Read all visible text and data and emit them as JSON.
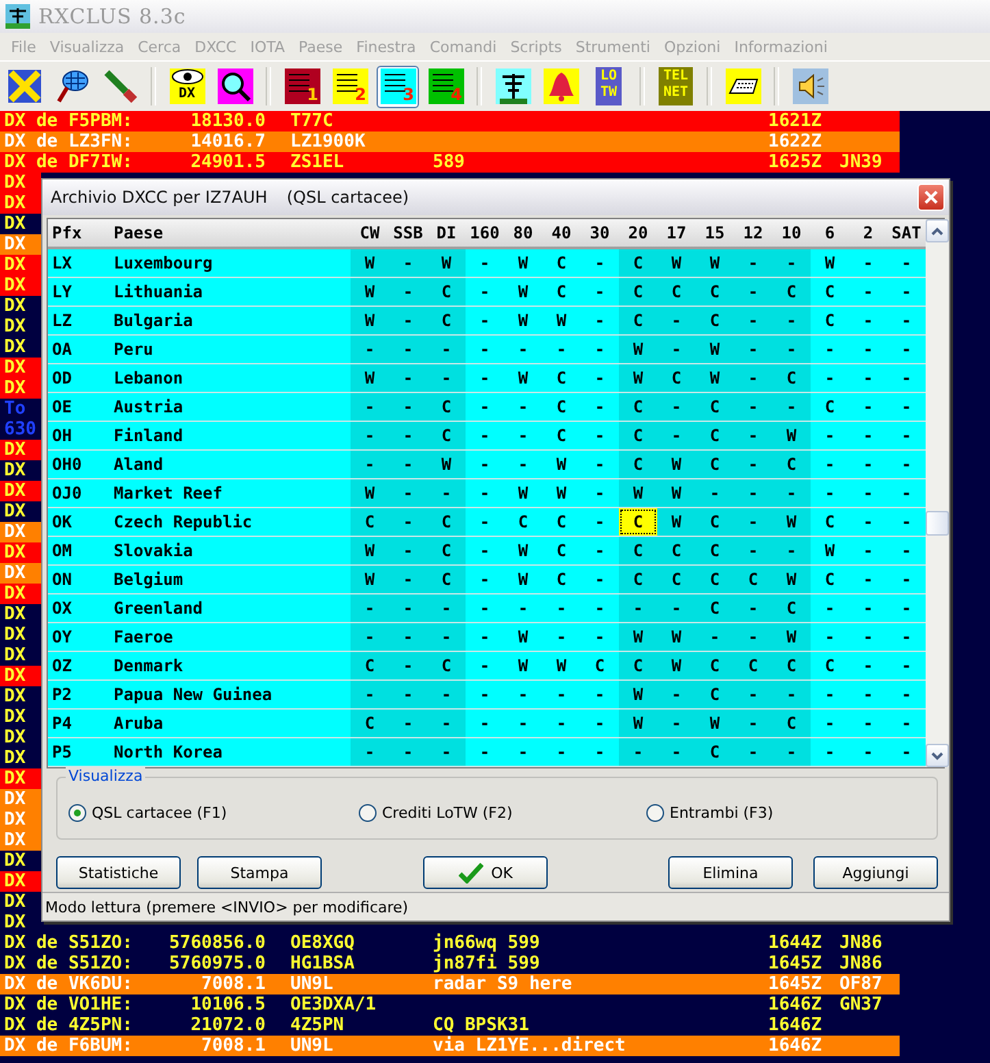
{
  "window": {
    "title": "RXCLUS 8.3c"
  },
  "menu": [
    "File",
    "Visualizza",
    "Cerca",
    "DXCC",
    "IOTA",
    "Paese",
    "Finestra",
    "Comandi",
    "Scripts",
    "Strumenti",
    "Opzioni",
    "Informazioni"
  ],
  "toolbar": [
    {
      "kind": "pencil",
      "selected": false
    },
    {
      "kind": "net",
      "selected": false
    },
    {
      "kind": "brush",
      "selected": false
    },
    {
      "kind": "separator"
    },
    {
      "kind": "eye",
      "label": "DX",
      "selected": false
    },
    {
      "kind": "magnifier",
      "selected": false
    },
    {
      "kind": "separator"
    },
    {
      "kind": "list",
      "label": "1",
      "color": "#b00020",
      "selected": false
    },
    {
      "kind": "list",
      "label": "2",
      "color": "#ffff00",
      "selected": false
    },
    {
      "kind": "list",
      "label": "3",
      "color": "#00ffff",
      "selected": true
    },
    {
      "kind": "list",
      "label": "4",
      "color": "#00c000",
      "selected": false
    },
    {
      "kind": "separator"
    },
    {
      "kind": "antenna",
      "selected": false
    },
    {
      "kind": "bell",
      "selected": false
    },
    {
      "kind": "letters",
      "label": "LOTW",
      "color": "#5a5ac8",
      "selected": false
    },
    {
      "kind": "separator"
    },
    {
      "kind": "letters",
      "label": "TELNET",
      "color": "#808000",
      "selected": false
    },
    {
      "kind": "separator"
    },
    {
      "kind": "keyboard",
      "selected": false
    },
    {
      "kind": "separator"
    },
    {
      "kind": "speaker",
      "selected": false
    }
  ],
  "spots": [
    {
      "kind": "spot",
      "color": "#ff0000",
      "de": "DX de F5PBM:",
      "freq": "18130.0",
      "dx": "T77C",
      "time": "1621Z"
    },
    {
      "kind": "spot",
      "color": "#ff8000",
      "de": "DX de LZ3FN:",
      "freq": "14016.7",
      "dx": "LZ1900K",
      "time": "1622Z"
    },
    {
      "kind": "spot",
      "color": "#ff0000",
      "de": "DX de DF7IW:",
      "freq": "24901.5",
      "dx": "ZS1EL",
      "comment": "589",
      "time": "1625Z",
      "locator": "JN39"
    },
    {
      "kind": "covered",
      "color": "#ff0000",
      "de": "DX"
    },
    {
      "kind": "covered",
      "color": "#ff0000",
      "de": "DX"
    },
    {
      "kind": "covered",
      "color": "#000040",
      "de": "DX"
    },
    {
      "kind": "covered",
      "color": "#ff8000",
      "de": "DX"
    },
    {
      "kind": "covered",
      "color": "#ff0000",
      "de": "DX"
    },
    {
      "kind": "covered",
      "color": "#ff0000",
      "de": "DX"
    },
    {
      "kind": "covered",
      "color": "#000040",
      "de": "DX"
    },
    {
      "kind": "covered",
      "color": "#000040",
      "de": "DX"
    },
    {
      "kind": "covered",
      "color": "#000040",
      "de": "DX"
    },
    {
      "kind": "covered",
      "color": "#ff0000",
      "de": "DX"
    },
    {
      "kind": "covered",
      "color": "#ff0000",
      "de": "DX"
    },
    {
      "kind": "message",
      "color": "#000040",
      "de": "To"
    },
    {
      "kind": "message",
      "color": "#000040",
      "de": "630"
    },
    {
      "kind": "covered",
      "color": "#ff0000",
      "de": "DX"
    },
    {
      "kind": "covered",
      "color": "#000040",
      "de": "DX"
    },
    {
      "kind": "covered",
      "color": "#ff0000",
      "de": "DX"
    },
    {
      "kind": "covered",
      "color": "#000040",
      "de": "DX"
    },
    {
      "kind": "covered",
      "color": "#ff8000",
      "de": "DX"
    },
    {
      "kind": "covered",
      "color": "#ff0000",
      "de": "DX"
    },
    {
      "kind": "covered",
      "color": "#ff8000",
      "de": "DX"
    },
    {
      "kind": "covered",
      "color": "#ff0000",
      "de": "DX"
    },
    {
      "kind": "covered",
      "color": "#000040",
      "de": "DX"
    },
    {
      "kind": "covered",
      "color": "#000040",
      "de": "DX"
    },
    {
      "kind": "covered",
      "color": "#000040",
      "de": "DX"
    },
    {
      "kind": "covered",
      "color": "#ff0000",
      "de": "DX"
    },
    {
      "kind": "covered",
      "color": "#000040",
      "de": "DX"
    },
    {
      "kind": "covered",
      "color": "#000040",
      "de": "DX"
    },
    {
      "kind": "covered",
      "color": "#000040",
      "de": "DX"
    },
    {
      "kind": "covered",
      "color": "#000040",
      "de": "DX"
    },
    {
      "kind": "covered",
      "color": "#ff0000",
      "de": "DX"
    },
    {
      "kind": "covered",
      "color": "#ff8000",
      "de": "DX"
    },
    {
      "kind": "covered",
      "color": "#ff8000",
      "de": "DX"
    },
    {
      "kind": "covered",
      "color": "#ff8000",
      "de": "DX"
    },
    {
      "kind": "covered",
      "color": "#000040",
      "de": "DX"
    },
    {
      "kind": "covered",
      "color": "#ff0000",
      "de": "DX"
    },
    {
      "kind": "covered",
      "color": "#000040",
      "de": "DX"
    },
    {
      "kind": "covered",
      "color": "#000040",
      "de": "DX"
    },
    {
      "kind": "spot",
      "color": "#000040",
      "de": "DX de S51ZO:",
      "freq": "5760856.0",
      "dx": "OE8XGQ",
      "comment": "jn66wq 599",
      "time": "1644Z",
      "locator": "JN86"
    },
    {
      "kind": "spot",
      "color": "#000040",
      "de": "DX de S51ZO:",
      "freq": "5760975.0",
      "dx": "HG1BSA",
      "comment": "jn87fi 599",
      "time": "1645Z",
      "locator": "JN86"
    },
    {
      "kind": "spot",
      "color": "#ff8000",
      "de": "DX de VK6DU:",
      "freq": "7008.1",
      "dx": "UN9L",
      "comment": "radar S9 here",
      "time": "1645Z",
      "locator": "OF87"
    },
    {
      "kind": "spot",
      "color": "#000040",
      "de": "DX de VO1HE:",
      "freq": "10106.5",
      "dx": "OE3DXA/1",
      "time": "1646Z",
      "locator": "GN37"
    },
    {
      "kind": "spot",
      "color": "#000040",
      "de": "DX de 4Z5PN:",
      "freq": "21072.0",
      "dx": "4Z5PN",
      "comment": "CQ BPSK31",
      "time": "1646Z"
    },
    {
      "kind": "spot",
      "color": "#ff8000",
      "de": "DX de F6BUM:",
      "freq": "7008.1",
      "dx": "UN9L",
      "comment": "via LZ1YE...direct",
      "time": "1646Z"
    }
  ],
  "dialog": {
    "title": "Archivio DXCC per IZ7AUH",
    "subtitle": "(QSL cartacee)",
    "table": {
      "columns": [
        {
          "label": "Pfx",
          "kind": "prefix"
        },
        {
          "label": "Paese",
          "kind": "country"
        },
        {
          "label": "CW",
          "kind": "band",
          "shaded": true
        },
        {
          "label": "SSB",
          "kind": "band",
          "shaded": true
        },
        {
          "label": "DI",
          "kind": "band",
          "shaded": true
        },
        {
          "label": "160",
          "kind": "band",
          "shaded": false
        },
        {
          "label": "80",
          "kind": "band",
          "shaded": false
        },
        {
          "label": "40",
          "kind": "band",
          "shaded": false
        },
        {
          "label": "30",
          "kind": "band",
          "shaded": false
        },
        {
          "label": "20",
          "kind": "band",
          "shaded": true
        },
        {
          "label": "17",
          "kind": "band",
          "shaded": true
        },
        {
          "label": "15",
          "kind": "band",
          "shaded": true
        },
        {
          "label": "12",
          "kind": "band",
          "shaded": true
        },
        {
          "label": "10",
          "kind": "band",
          "shaded": true
        },
        {
          "label": "6",
          "kind": "band",
          "shaded": false
        },
        {
          "label": "2",
          "kind": "band",
          "shaded": false
        },
        {
          "label": "SAT",
          "kind": "band",
          "shaded": false
        }
      ],
      "rows": [
        {
          "prefix": "LX",
          "country": "Luxembourg",
          "bands": [
            {
              "value": "W",
              "selected": false
            },
            {
              "value": "-",
              "selected": false
            },
            {
              "value": "W",
              "selected": false
            },
            {
              "value": "-",
              "selected": false
            },
            {
              "value": "W",
              "selected": false
            },
            {
              "value": "C",
              "selected": false
            },
            {
              "value": "-",
              "selected": false
            },
            {
              "value": "C",
              "selected": false
            },
            {
              "value": "W",
              "selected": false
            },
            {
              "value": "W",
              "selected": false
            },
            {
              "value": "-",
              "selected": false
            },
            {
              "value": "-",
              "selected": false
            },
            {
              "value": "W",
              "selected": false
            },
            {
              "value": "-",
              "selected": false
            },
            {
              "value": "-",
              "selected": false
            }
          ]
        },
        {
          "prefix": "LY",
          "country": "Lithuania",
          "bands": [
            {
              "value": "W",
              "selected": false
            },
            {
              "value": "-",
              "selected": false
            },
            {
              "value": "C",
              "selected": false
            },
            {
              "value": "-",
              "selected": false
            },
            {
              "value": "W",
              "selected": false
            },
            {
              "value": "C",
              "selected": false
            },
            {
              "value": "-",
              "selected": false
            },
            {
              "value": "C",
              "selected": false
            },
            {
              "value": "C",
              "selected": false
            },
            {
              "value": "C",
              "selected": false
            },
            {
              "value": "-",
              "selected": false
            },
            {
              "value": "C",
              "selected": false
            },
            {
              "value": "C",
              "selected": false
            },
            {
              "value": "-",
              "selected": false
            },
            {
              "value": "-",
              "selected": false
            }
          ]
        },
        {
          "prefix": "LZ",
          "country": "Bulgaria",
          "bands": [
            {
              "value": "W",
              "selected": false
            },
            {
              "value": "-",
              "selected": false
            },
            {
              "value": "C",
              "selected": false
            },
            {
              "value": "-",
              "selected": false
            },
            {
              "value": "W",
              "selected": false
            },
            {
              "value": "W",
              "selected": false
            },
            {
              "value": "-",
              "selected": false
            },
            {
              "value": "C",
              "selected": false
            },
            {
              "value": "-",
              "selected": false
            },
            {
              "value": "C",
              "selected": false
            },
            {
              "value": "-",
              "selected": false
            },
            {
              "value": "-",
              "selected": false
            },
            {
              "value": "C",
              "selected": false
            },
            {
              "value": "-",
              "selected": false
            },
            {
              "value": "-",
              "selected": false
            }
          ]
        },
        {
          "prefix": "OA",
          "country": "Peru",
          "bands": [
            {
              "value": "-",
              "selected": false
            },
            {
              "value": "-",
              "selected": false
            },
            {
              "value": "-",
              "selected": false
            },
            {
              "value": "-",
              "selected": false
            },
            {
              "value": "-",
              "selected": false
            },
            {
              "value": "-",
              "selected": false
            },
            {
              "value": "-",
              "selected": false
            },
            {
              "value": "W",
              "selected": false
            },
            {
              "value": "-",
              "selected": false
            },
            {
              "value": "W",
              "selected": false
            },
            {
              "value": "-",
              "selected": false
            },
            {
              "value": "-",
              "selected": false
            },
            {
              "value": "-",
              "selected": false
            },
            {
              "value": "-",
              "selected": false
            },
            {
              "value": "-",
              "selected": false
            }
          ]
        },
        {
          "prefix": "OD",
          "country": "Lebanon",
          "bands": [
            {
              "value": "W",
              "selected": false
            },
            {
              "value": "-",
              "selected": false
            },
            {
              "value": "-",
              "selected": false
            },
            {
              "value": "-",
              "selected": false
            },
            {
              "value": "W",
              "selected": false
            },
            {
              "value": "C",
              "selected": false
            },
            {
              "value": "-",
              "selected": false
            },
            {
              "value": "W",
              "selected": false
            },
            {
              "value": "C",
              "selected": false
            },
            {
              "value": "W",
              "selected": false
            },
            {
              "value": "-",
              "selected": false
            },
            {
              "value": "C",
              "selected": false
            },
            {
              "value": "-",
              "selected": false
            },
            {
              "value": "-",
              "selected": false
            },
            {
              "value": "-",
              "selected": false
            }
          ]
        },
        {
          "prefix": "OE",
          "country": "Austria",
          "bands": [
            {
              "value": "-",
              "selected": false
            },
            {
              "value": "-",
              "selected": false
            },
            {
              "value": "C",
              "selected": false
            },
            {
              "value": "-",
              "selected": false
            },
            {
              "value": "-",
              "selected": false
            },
            {
              "value": "C",
              "selected": false
            },
            {
              "value": "-",
              "selected": false
            },
            {
              "value": "C",
              "selected": false
            },
            {
              "value": "-",
              "selected": false
            },
            {
              "value": "C",
              "selected": false
            },
            {
              "value": "-",
              "selected": false
            },
            {
              "value": "-",
              "selected": false
            },
            {
              "value": "C",
              "selected": false
            },
            {
              "value": "-",
              "selected": false
            },
            {
              "value": "-",
              "selected": false
            }
          ]
        },
        {
          "prefix": "OH",
          "country": "Finland",
          "bands": [
            {
              "value": "-",
              "selected": false
            },
            {
              "value": "-",
              "selected": false
            },
            {
              "value": "C",
              "selected": false
            },
            {
              "value": "-",
              "selected": false
            },
            {
              "value": "-",
              "selected": false
            },
            {
              "value": "C",
              "selected": false
            },
            {
              "value": "-",
              "selected": false
            },
            {
              "value": "C",
              "selected": false
            },
            {
              "value": "-",
              "selected": false
            },
            {
              "value": "C",
              "selected": false
            },
            {
              "value": "-",
              "selected": false
            },
            {
              "value": "W",
              "selected": false
            },
            {
              "value": "-",
              "selected": false
            },
            {
              "value": "-",
              "selected": false
            },
            {
              "value": "-",
              "selected": false
            }
          ]
        },
        {
          "prefix": "OH0",
          "country": "Aland",
          "bands": [
            {
              "value": "-",
              "selected": false
            },
            {
              "value": "-",
              "selected": false
            },
            {
              "value": "W",
              "selected": false
            },
            {
              "value": "-",
              "selected": false
            },
            {
              "value": "-",
              "selected": false
            },
            {
              "value": "W",
              "selected": false
            },
            {
              "value": "-",
              "selected": false
            },
            {
              "value": "C",
              "selected": false
            },
            {
              "value": "W",
              "selected": false
            },
            {
              "value": "C",
              "selected": false
            },
            {
              "value": "-",
              "selected": false
            },
            {
              "value": "C",
              "selected": false
            },
            {
              "value": "-",
              "selected": false
            },
            {
              "value": "-",
              "selected": false
            },
            {
              "value": "-",
              "selected": false
            }
          ]
        },
        {
          "prefix": "OJ0",
          "country": "Market Reef",
          "bands": [
            {
              "value": "W",
              "selected": false
            },
            {
              "value": "-",
              "selected": false
            },
            {
              "value": "-",
              "selected": false
            },
            {
              "value": "-",
              "selected": false
            },
            {
              "value": "W",
              "selected": false
            },
            {
              "value": "W",
              "selected": false
            },
            {
              "value": "-",
              "selected": false
            },
            {
              "value": "W",
              "selected": false
            },
            {
              "value": "W",
              "selected": false
            },
            {
              "value": "-",
              "selected": false
            },
            {
              "value": "-",
              "selected": false
            },
            {
              "value": "-",
              "selected": false
            },
            {
              "value": "-",
              "selected": false
            },
            {
              "value": "-",
              "selected": false
            },
            {
              "value": "-",
              "selected": false
            }
          ]
        },
        {
          "prefix": "OK",
          "country": "Czech Republic",
          "bands": [
            {
              "value": "C",
              "selected": false
            },
            {
              "value": "-",
              "selected": false
            },
            {
              "value": "C",
              "selected": false
            },
            {
              "value": "-",
              "selected": false
            },
            {
              "value": "C",
              "selected": false
            },
            {
              "value": "C",
              "selected": false
            },
            {
              "value": "-",
              "selected": false
            },
            {
              "value": "C",
              "selected": true
            },
            {
              "value": "W",
              "selected": false
            },
            {
              "value": "C",
              "selected": false
            },
            {
              "value": "-",
              "selected": false
            },
            {
              "value": "W",
              "selected": false
            },
            {
              "value": "C",
              "selected": false
            },
            {
              "value": "-",
              "selected": false
            },
            {
              "value": "-",
              "selected": false
            }
          ]
        },
        {
          "prefix": "OM",
          "country": "Slovakia",
          "bands": [
            {
              "value": "W",
              "selected": false
            },
            {
              "value": "-",
              "selected": false
            },
            {
              "value": "C",
              "selected": false
            },
            {
              "value": "-",
              "selected": false
            },
            {
              "value": "W",
              "selected": false
            },
            {
              "value": "C",
              "selected": false
            },
            {
              "value": "-",
              "selected": false
            },
            {
              "value": "C",
              "selected": false
            },
            {
              "value": "C",
              "selected": false
            },
            {
              "value": "C",
              "selected": false
            },
            {
              "value": "-",
              "selected": false
            },
            {
              "value": "-",
              "selected": false
            },
            {
              "value": "W",
              "selected": false
            },
            {
              "value": "-",
              "selected": false
            },
            {
              "value": "-",
              "selected": false
            }
          ]
        },
        {
          "prefix": "ON",
          "country": "Belgium",
          "bands": [
            {
              "value": "W",
              "selected": false
            },
            {
              "value": "-",
              "selected": false
            },
            {
              "value": "C",
              "selected": false
            },
            {
              "value": "-",
              "selected": false
            },
            {
              "value": "W",
              "selected": false
            },
            {
              "value": "C",
              "selected": false
            },
            {
              "value": "-",
              "selected": false
            },
            {
              "value": "C",
              "selected": false
            },
            {
              "value": "C",
              "selected": false
            },
            {
              "value": "C",
              "selected": false
            },
            {
              "value": "C",
              "selected": false
            },
            {
              "value": "W",
              "selected": false
            },
            {
              "value": "C",
              "selected": false
            },
            {
              "value": "-",
              "selected": false
            },
            {
              "value": "-",
              "selected": false
            }
          ]
        },
        {
          "prefix": "OX",
          "country": "Greenland",
          "bands": [
            {
              "value": "-",
              "selected": false
            },
            {
              "value": "-",
              "selected": false
            },
            {
              "value": "-",
              "selected": false
            },
            {
              "value": "-",
              "selected": false
            },
            {
              "value": "-",
              "selected": false
            },
            {
              "value": "-",
              "selected": false
            },
            {
              "value": "-",
              "selected": false
            },
            {
              "value": "-",
              "selected": false
            },
            {
              "value": "-",
              "selected": false
            },
            {
              "value": "C",
              "selected": false
            },
            {
              "value": "-",
              "selected": false
            },
            {
              "value": "C",
              "selected": false
            },
            {
              "value": "-",
              "selected": false
            },
            {
              "value": "-",
              "selected": false
            },
            {
              "value": "-",
              "selected": false
            }
          ]
        },
        {
          "prefix": "OY",
          "country": "Faeroe",
          "bands": [
            {
              "value": "-",
              "selected": false
            },
            {
              "value": "-",
              "selected": false
            },
            {
              "value": "-",
              "selected": false
            },
            {
              "value": "-",
              "selected": false
            },
            {
              "value": "W",
              "selected": false
            },
            {
              "value": "-",
              "selected": false
            },
            {
              "value": "-",
              "selected": false
            },
            {
              "value": "W",
              "selected": false
            },
            {
              "value": "W",
              "selected": false
            },
            {
              "value": "-",
              "selected": false
            },
            {
              "value": "-",
              "selected": false
            },
            {
              "value": "W",
              "selected": false
            },
            {
              "value": "-",
              "selected": false
            },
            {
              "value": "-",
              "selected": false
            },
            {
              "value": "-",
              "selected": false
            }
          ]
        },
        {
          "prefix": "OZ",
          "country": "Denmark",
          "bands": [
            {
              "value": "C",
              "selected": false
            },
            {
              "value": "-",
              "selected": false
            },
            {
              "value": "C",
              "selected": false
            },
            {
              "value": "-",
              "selected": false
            },
            {
              "value": "W",
              "selected": false
            },
            {
              "value": "W",
              "selected": false
            },
            {
              "value": "C",
              "selected": false
            },
            {
              "value": "C",
              "selected": false
            },
            {
              "value": "W",
              "selected": false
            },
            {
              "value": "C",
              "selected": false
            },
            {
              "value": "C",
              "selected": false
            },
            {
              "value": "C",
              "selected": false
            },
            {
              "value": "C",
              "selected": false
            },
            {
              "value": "-",
              "selected": false
            },
            {
              "value": "-",
              "selected": false
            }
          ]
        },
        {
          "prefix": "P2",
          "country": "Papua New Guinea",
          "bands": [
            {
              "value": "-",
              "selected": false
            },
            {
              "value": "-",
              "selected": false
            },
            {
              "value": "-",
              "selected": false
            },
            {
              "value": "-",
              "selected": false
            },
            {
              "value": "-",
              "selected": false
            },
            {
              "value": "-",
              "selected": false
            },
            {
              "value": "-",
              "selected": false
            },
            {
              "value": "W",
              "selected": false
            },
            {
              "value": "-",
              "selected": false
            },
            {
              "value": "C",
              "selected": false
            },
            {
              "value": "-",
              "selected": false
            },
            {
              "value": "-",
              "selected": false
            },
            {
              "value": "-",
              "selected": false
            },
            {
              "value": "-",
              "selected": false
            },
            {
              "value": "-",
              "selected": false
            }
          ]
        },
        {
          "prefix": "P4",
          "country": "Aruba",
          "bands": [
            {
              "value": "C",
              "selected": false
            },
            {
              "value": "-",
              "selected": false
            },
            {
              "value": "-",
              "selected": false
            },
            {
              "value": "-",
              "selected": false
            },
            {
              "value": "-",
              "selected": false
            },
            {
              "value": "-",
              "selected": false
            },
            {
              "value": "-",
              "selected": false
            },
            {
              "value": "W",
              "selected": false
            },
            {
              "value": "-",
              "selected": false
            },
            {
              "value": "W",
              "selected": false
            },
            {
              "value": "-",
              "selected": false
            },
            {
              "value": "C",
              "selected": false
            },
            {
              "value": "-",
              "selected": false
            },
            {
              "value": "-",
              "selected": false
            },
            {
              "value": "-",
              "selected": false
            }
          ]
        },
        {
          "prefix": "P5",
          "country": "North Korea",
          "bands": [
            {
              "value": "-",
              "selected": false
            },
            {
              "value": "-",
              "selected": false
            },
            {
              "value": "-",
              "selected": false
            },
            {
              "value": "-",
              "selected": false
            },
            {
              "value": "-",
              "selected": false
            },
            {
              "value": "-",
              "selected": false
            },
            {
              "value": "-",
              "selected": false
            },
            {
              "value": "-",
              "selected": false
            },
            {
              "value": "-",
              "selected": false
            },
            {
              "value": "C",
              "selected": false
            },
            {
              "value": "-",
              "selected": false
            },
            {
              "value": "-",
              "selected": false
            },
            {
              "value": "-",
              "selected": false
            },
            {
              "value": "-",
              "selected": false
            },
            {
              "value": "-",
              "selected": false
            }
          ]
        }
      ]
    },
    "group": {
      "title": "Visualizza",
      "options": [
        {
          "label": "QSL cartacee (F1)",
          "selected": true
        },
        {
          "label": "Crediti LoTW (F2)",
          "selected": false
        },
        {
          "label": "Entrambi (F3)",
          "selected": false
        }
      ]
    },
    "buttons": [
      {
        "label": "Statistiche",
        "kind": "plain"
      },
      {
        "label": "Stampa",
        "kind": "plain"
      },
      {
        "label": "OK",
        "kind": "ok"
      },
      {
        "label": "Elimina",
        "kind": "plain"
      },
      {
        "label": "Aggiungi",
        "kind": "plain"
      }
    ],
    "status": "Modo lettura (premere <INVIO> per modificare)"
  }
}
